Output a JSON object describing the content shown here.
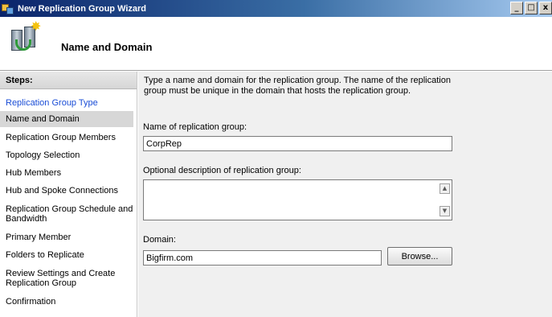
{
  "window": {
    "title": "New Replication Group Wizard",
    "buttons": {
      "minimize": "_",
      "maximize": "□",
      "close": "x"
    }
  },
  "header": {
    "title": "Name and Domain"
  },
  "steps": {
    "heading": "Steps:",
    "items": [
      {
        "label": "Replication Group Type",
        "state": "link"
      },
      {
        "label": "Name and Domain",
        "state": "active"
      },
      {
        "label": "Replication Group Members",
        "state": "normal"
      },
      {
        "label": "Topology Selection",
        "state": "normal"
      },
      {
        "label": "Hub Members",
        "state": "normal"
      },
      {
        "label": "Hub and Spoke Connections",
        "state": "normal"
      },
      {
        "label": "Replication Group Schedule and Bandwidth",
        "state": "normal"
      },
      {
        "label": "Primary Member",
        "state": "normal"
      },
      {
        "label": "Folders to Replicate",
        "state": "normal"
      },
      {
        "label": "Review Settings and Create Replication Group",
        "state": "normal"
      },
      {
        "label": "Confirmation",
        "state": "normal"
      }
    ]
  },
  "form": {
    "intro": "Type a name and domain for the replication group. The name of the replication group must be unique in the domain that hosts the replication group.",
    "name_label": "Name of replication group:",
    "name_value": "CorpRep",
    "description_label": "Optional description of replication group:",
    "description_value": "",
    "domain_label": "Domain:",
    "domain_value": "Bigfirm.com",
    "browse_label": "Browse..."
  },
  "colors": {
    "titlebar_start": "#0a246a",
    "link": "#1a4dd6",
    "active_step_bg": "#d7d7d7",
    "content_bg": "#f0f0f0"
  }
}
